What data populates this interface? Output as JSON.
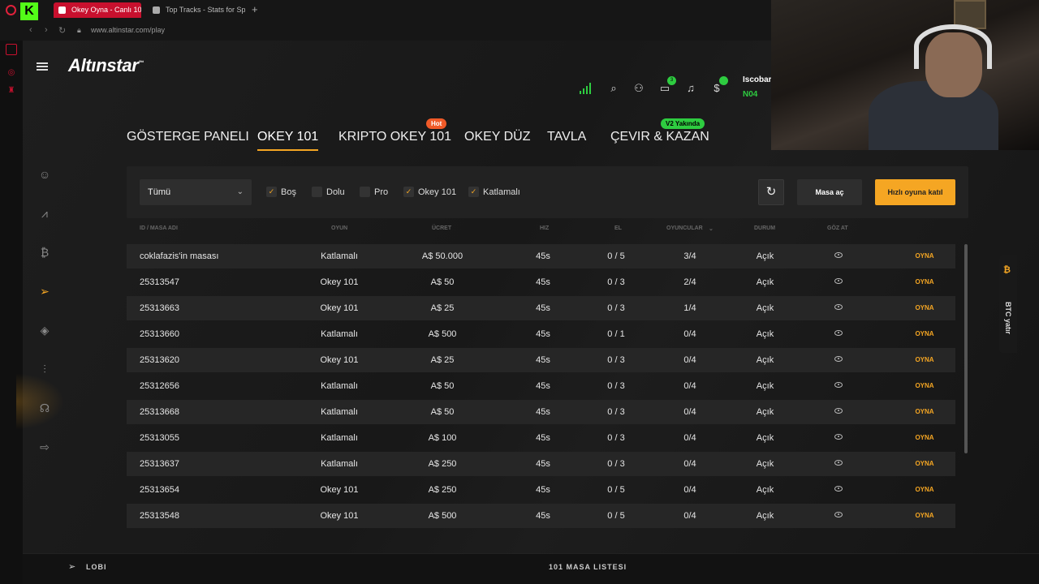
{
  "browser": {
    "tabs": [
      {
        "title": "Okey Oyna - Canlı 101 Ok",
        "active": true
      },
      {
        "title": "Top Tracks - Stats for Sp",
        "active": false
      }
    ],
    "new_tab": "+",
    "url": "www.altinstar.com/play",
    "kick_label": "K",
    "accent_color": "#c8102e"
  },
  "app": {
    "logo": "Altınstar",
    "logo_tm": "™",
    "user": {
      "name": "Iscobar",
      "level": "N04"
    },
    "notif_count": "3",
    "colors": {
      "accent": "#f5a623",
      "online": "#2ecc40",
      "hot": "#f05a28"
    }
  },
  "tabs": [
    {
      "label": "GÖSTERGE PANELI"
    },
    {
      "label": "OKEY 101",
      "active": true
    },
    {
      "label": "KRIPTO OKEY 101",
      "badge": "Hot"
    },
    {
      "label": "OKEY DÜZ"
    },
    {
      "label": "TAVLA"
    },
    {
      "label": "ÇEVIR & KAZAN",
      "badge": "V2 Yakında"
    }
  ],
  "filters": {
    "select_value": "Tümü",
    "checkboxes": [
      {
        "label": "Boş",
        "checked": true
      },
      {
        "label": "Dolu",
        "checked": false
      },
      {
        "label": "Pro",
        "checked": false
      },
      {
        "label": "Okey 101",
        "checked": true
      },
      {
        "label": "Katlamalı",
        "checked": true
      }
    ],
    "masa_ac": "Masa aç",
    "quick_join": "Hızlı oyuna katıl"
  },
  "table": {
    "headers": [
      "ID / MASA ADI",
      "OYUN",
      "ÜCRET",
      "HIZ",
      "EL",
      "OYUNCULAR",
      "DURUM",
      "GÖZ AT"
    ],
    "play_label": "OYNA",
    "rows": [
      [
        "coklafazis'in masası",
        "Katlamalı",
        "A$  50.000",
        "45s",
        "0 / 5",
        "3/4",
        "Açık"
      ],
      [
        "25313547",
        "Okey 101",
        "A$  50",
        "45s",
        "0 / 3",
        "2/4",
        "Açık"
      ],
      [
        "25313663",
        "Okey 101",
        "A$  25",
        "45s",
        "0 / 3",
        "1/4",
        "Açık"
      ],
      [
        "25313660",
        "Katlamalı",
        "A$  500",
        "45s",
        "0 / 1",
        "0/4",
        "Açık"
      ],
      [
        "25313620",
        "Okey 101",
        "A$  25",
        "45s",
        "0 / 3",
        "0/4",
        "Açık"
      ],
      [
        "25312656",
        "Katlamalı",
        "A$  50",
        "45s",
        "0 / 3",
        "0/4",
        "Açık"
      ],
      [
        "25313668",
        "Katlamalı",
        "A$  50",
        "45s",
        "0 / 3",
        "0/4",
        "Açık"
      ],
      [
        "25313055",
        "Katlamalı",
        "A$  100",
        "45s",
        "0 / 3",
        "0/4",
        "Açık"
      ],
      [
        "25313637",
        "Katlamalı",
        "A$  250",
        "45s",
        "0 / 3",
        "0/4",
        "Açık"
      ],
      [
        "25313654",
        "Okey 101",
        "A$  250",
        "45s",
        "0 / 5",
        "0/4",
        "Açık"
      ],
      [
        "25313548",
        "Okey 101",
        "A$  500",
        "45s",
        "0 / 5",
        "0/4",
        "Açık"
      ]
    ]
  },
  "side_tab": {
    "icon": "₿",
    "label": "BTC yatır"
  },
  "footer": {
    "lobi": "LOBI",
    "masa_list": "101 MASA LISTESI"
  }
}
